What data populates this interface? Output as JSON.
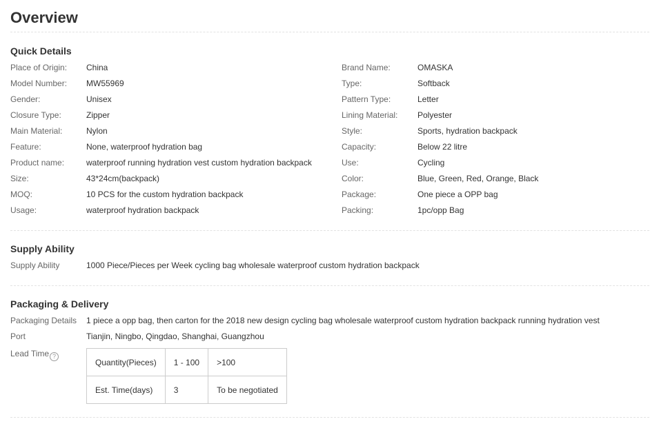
{
  "page_title": "Overview",
  "quick_details": {
    "title": "Quick Details",
    "left": [
      {
        "key": "Place of Origin:",
        "value": "China"
      },
      {
        "key": "Model Number:",
        "value": "MW55969"
      },
      {
        "key": "Gender:",
        "value": "Unisex"
      },
      {
        "key": "Closure Type:",
        "value": "Zipper"
      },
      {
        "key": "Main Material:",
        "value": "Nylon"
      },
      {
        "key": "Feature:",
        "value": "None, waterproof hydration bag"
      },
      {
        "key": "Product name:",
        "value": "waterproof running hydration vest custom hydration backpack"
      },
      {
        "key": "Size:",
        "value": "43*24cm(backpack)"
      },
      {
        "key": "MOQ:",
        "value": "10 PCS for the custom hydration backpack"
      },
      {
        "key": "Usage:",
        "value": "waterproof hydration backpack"
      }
    ],
    "right": [
      {
        "key": "Brand Name:",
        "value": "OMASKA"
      },
      {
        "key": "Type:",
        "value": "Softback"
      },
      {
        "key": "Pattern Type:",
        "value": "Letter"
      },
      {
        "key": "Lining Material:",
        "value": "Polyester"
      },
      {
        "key": "Style:",
        "value": "Sports, hydration backpack"
      },
      {
        "key": "Capacity:",
        "value": "Below 22 litre"
      },
      {
        "key": "Use:",
        "value": "Cycling"
      },
      {
        "key": "Color:",
        "value": "Blue, Green, Red, Orange, Black"
      },
      {
        "key": "Package:",
        "value": "One piece a OPP bag"
      },
      {
        "key": "Packing:",
        "value": "1pc/opp Bag"
      }
    ]
  },
  "supply_ability": {
    "title": "Supply Ability",
    "rows": [
      {
        "key": "Supply Ability",
        "value": "1000 Piece/Pieces per Week cycling bag wholesale waterproof custom hydration backpack"
      }
    ]
  },
  "packaging_delivery": {
    "title": "Packaging & Delivery",
    "rows": [
      {
        "key": "Packaging Details",
        "value": "1 piece a opp bag, then carton for the 2018 new design cycling bag wholesale waterproof custom hydration backpack running hydration vest"
      },
      {
        "key": "Port",
        "value": "Tianjin, Ningbo, Qingdao, Shanghai, Guangzhou"
      }
    ],
    "lead_time_label": "Lead Time",
    "lead_time_icon": "question-circle-icon",
    "lead_table": {
      "row1": [
        "Quantity(Pieces)",
        "1 - 100",
        ">100"
      ],
      "row2": [
        "Est. Time(days)",
        "3",
        "To be negotiated"
      ]
    }
  }
}
